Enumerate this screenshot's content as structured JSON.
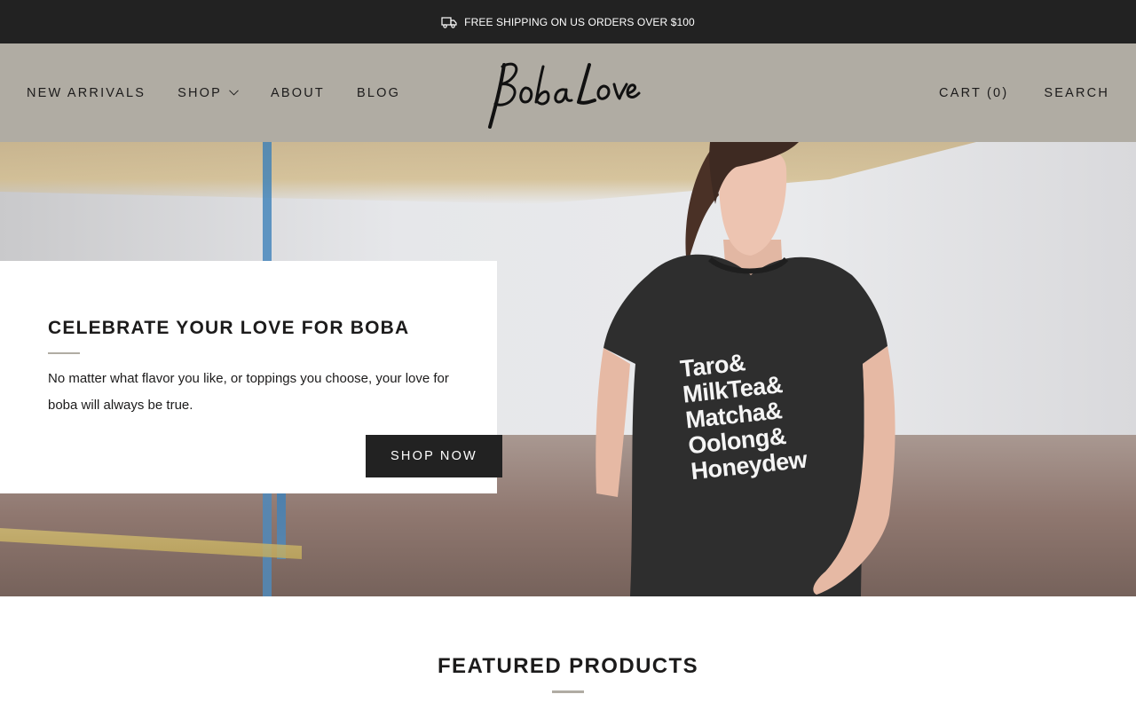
{
  "announcement": {
    "text": "FREE SHIPPING ON US ORDERS OVER $100",
    "icon": "truck-icon"
  },
  "header": {
    "nav_left": [
      {
        "label": "NEW ARRIVALS"
      },
      {
        "label": "SHOP",
        "has_dropdown": true
      },
      {
        "label": "ABOUT"
      },
      {
        "label": "BLOG"
      }
    ],
    "logo_text": "Boba Love",
    "cart_label": "CART (0)",
    "search_label": "SEARCH"
  },
  "hero": {
    "title": "CELEBRATE YOUR LOVE FOR BOBA",
    "description": "No matter what flavor you like, or toppings you choose, your love for boba will always be true.",
    "button_label": "SHOP NOW",
    "shirt_lines": [
      "Taro&",
      "MilkTea&",
      "Matcha&",
      "Oolong&",
      "Honeydew"
    ]
  },
  "featured": {
    "title": "FEATURED PRODUCTS"
  },
  "colors": {
    "header_bg": "#b0aca3",
    "dark": "#222222",
    "accent_rule": "#b0aca3"
  }
}
